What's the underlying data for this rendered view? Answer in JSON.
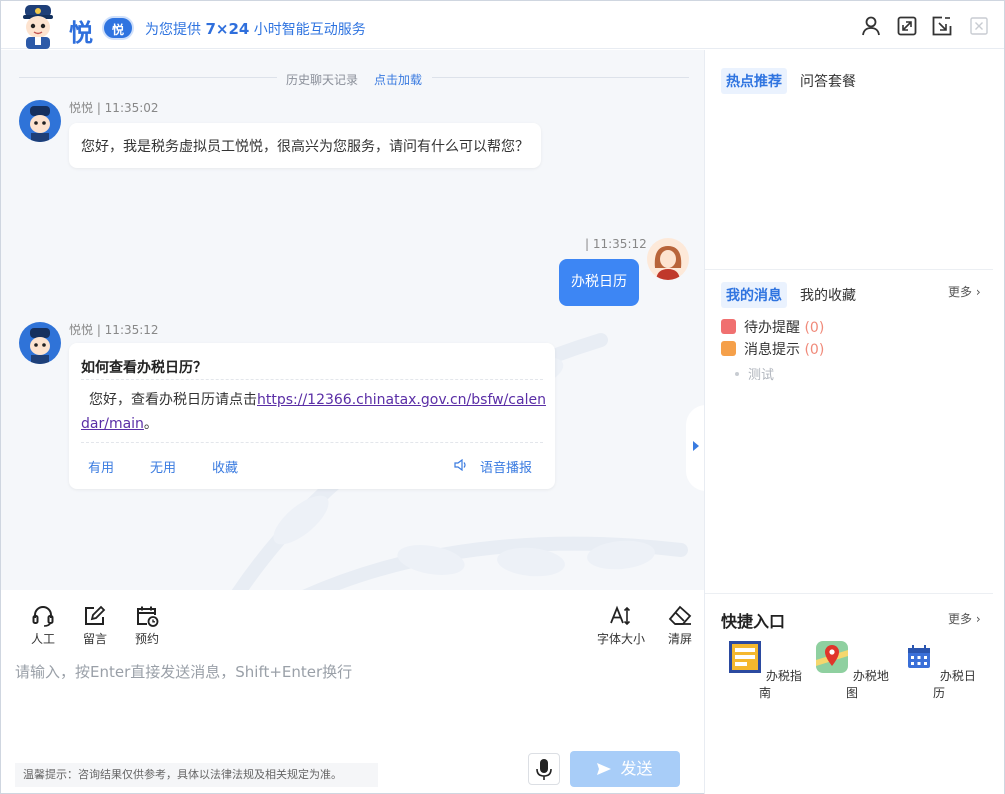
{
  "header": {
    "brand_char": "悦",
    "badge_char": "悦",
    "slogan_prefix": "为您提供",
    "slogan_hours": "7×24",
    "slogan_suffix": "小时智能互动服务"
  },
  "history": {
    "label": "历史聊天记录",
    "link": "点击加载"
  },
  "messages": {
    "bot1_meta": "悦悦 | 11:35:02",
    "bot1_text": "您好，我是税务虚拟员工悦悦，很高兴为您服务，请问有什么可以帮您？",
    "user_meta": "| 11:35:12",
    "user_text": "办税日历",
    "bot2_meta": "悦悦 | 11:35:12",
    "bot2_title": "如何查看办税日历？",
    "bot2_prefix": "您好，查看办税日历请点击",
    "bot2_link": "https://12366.chinatax.gov.cn/bsfw/calendar/main",
    "bot2_suffix": "。",
    "action_useful": "有用",
    "action_useless": "无用",
    "action_collect": "收藏",
    "action_voice": "语音播报"
  },
  "toolbar": {
    "agent": "人工",
    "leave_msg": "留言",
    "appointment": "预约",
    "font_size": "字体大小",
    "clear": "清屏"
  },
  "input": {
    "placeholder": "请输入，按Enter直接发送消息，Shift+Enter换行"
  },
  "tip": "温馨提示：咨询结果仅供参考，具体以法律法规及相关规定为准。",
  "send_label": "发送",
  "right": {
    "hot_tab": "热点推荐",
    "qa_tab": "问答套餐",
    "my_msg_tab": "我的消息",
    "my_fav_tab": "我的收藏",
    "more1": "更多",
    "todo_label": "待办提醒",
    "todo_count": "(0)",
    "notice_label": "消息提示",
    "notice_count": "(0)",
    "test_item": "测试",
    "quick_title": "快捷入口",
    "more2": "更多",
    "quick_items": [
      "办税指南",
      "办税地图",
      "办税日历"
    ]
  }
}
